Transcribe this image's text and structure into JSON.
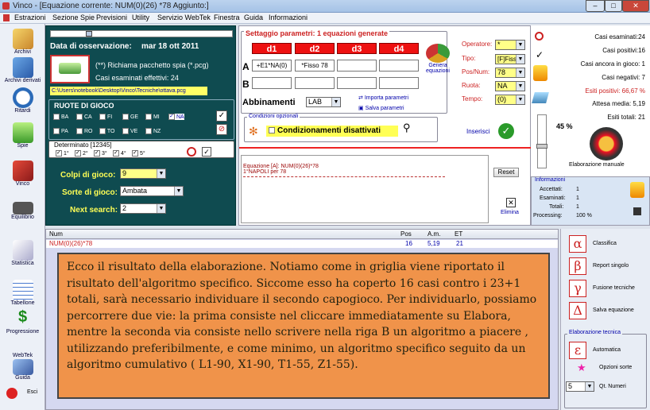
{
  "window": {
    "title": "Vinco - [Equazione corrente: NUM(0)(26) *78 Aggiunto:]"
  },
  "menu": [
    "Estrazioni",
    "Sezione Spie",
    "Previsioni",
    "Utility",
    "Servizio WebTek",
    "Finestra",
    "Guida",
    "Informazioni"
  ],
  "sidebar": [
    "Archivi",
    "Archivi derivati",
    "Ritardi",
    "Spie",
    "Vinco",
    "Equilibrio",
    "Statistica",
    "Tabellone",
    "Progressione",
    "WebTek",
    "Guida",
    "Esci"
  ],
  "obs": {
    "label": "Data di osservazione:",
    "date": "mar 18 ott 2011",
    "recall": "(**) Richiama pacchetto spia (*.pcg)",
    "cases": "Casi esaminati effettivi: 24",
    "path": "C:\\Users\\notebook\\Desktop\\Vinco\\Tecniche\\ottava.pcg"
  },
  "ruote": {
    "title": "RUOTE DI GIOCO",
    "items": [
      "BA",
      "CA",
      "FI",
      "GE",
      "MI",
      "NA",
      "PA",
      "RO",
      "TO",
      "VE",
      "NZ"
    ],
    "checked": "NA"
  },
  "determinato": {
    "title": "Determinato [12345]",
    "items": [
      "1°",
      "2°",
      "3°",
      "4°",
      "5°"
    ]
  },
  "colpi": {
    "label": "Colpi di gioco:",
    "value": "9"
  },
  "sorte": {
    "label": "Sorte di gioco:",
    "value": "Ambata"
  },
  "next": {
    "label": "Next search:",
    "value": "2"
  },
  "settaggio": {
    "title": "Settaggio parametri: 1 equazioni generate",
    "d": [
      "d1",
      "d2",
      "d3",
      "d4"
    ],
    "rowA": [
      "+E1*NA(0)",
      "*Fisso 78",
      "",
      ""
    ],
    "genera": "Genera equazioni"
  },
  "params": {
    "operatore": {
      "label": "Operatore:",
      "value": "*"
    },
    "tipo": {
      "label": "Tipo:",
      "value": "[F]Fisso"
    },
    "posnum": {
      "label": "Pos/Num:",
      "value": "78"
    },
    "ruota": {
      "label": "Ruota:",
      "value": "NA"
    },
    "tempo": {
      "label": "Tempo:",
      "value": "(0)"
    }
  },
  "abbinamenti": {
    "label": "Abbinamenti",
    "value": "LAB",
    "importa": "Importa parametri",
    "salva": "Salva parametri"
  },
  "condizioni": {
    "legend": "Condizioni opzionali",
    "text": "Condizionamenti disattivati",
    "inserisci": "Inserisci"
  },
  "equazione": {
    "line1": "Equazione [A]: NUM(0)(26)*78",
    "line2": "1°NAPOLI per 78",
    "reset": "Reset",
    "elimina": "Elimina"
  },
  "stats": {
    "esaminati": "Casi esaminati:24",
    "positivi": "Casi positivi:16",
    "ancora": "Casi ancora in gioco: 1",
    "negativi": "Casi negativi: 7",
    "esiti": "Esiti positivi: 66,67 %",
    "attesa": "Attesa media: 5,19",
    "totali": "Esiti totali: 21",
    "perc": "45 %",
    "manuale": "Elaborazione manuale"
  },
  "info": {
    "legend": "Informazioni",
    "accettati": "Accettati:",
    "acc_v": "1",
    "esaminati": "Esaminati:",
    "esa_v": "1",
    "totali": "Totali:",
    "tot_v": "1",
    "processing": "Processing:",
    "proc_v": "100 %"
  },
  "grid": {
    "headers": [
      "Num",
      "Pos",
      "A.m.",
      "ET"
    ],
    "row": [
      "NUM(0)(26)*78",
      "16",
      "5,19",
      "21"
    ]
  },
  "message": "Ecco il risultato della elaborazione. Notiamo come in griglia viene riportato il risultato dell'algoritmo specifico. Siccome esso ha coperto 16 casi contro i 23+1 totali, sarà necessario individuare il secondo capogioco. Per individuarlo, possiamo percorrere due vie: la prima consiste nel cliccare immediatamente su Elabora, mentre la seconda via consiste nello scrivere nella riga B un algoritmo a piacere , utilizzando preferibilmente, e come minimo, un algoritmo specifico seguito da un algoritmo cumulativo ( L1-90, X1-90, T1-55, Z1-55).",
  "tools": {
    "classifica": "Classifica",
    "report": "Report singolo",
    "fusione": "Fusione tecniche",
    "salva": "Salva equazione",
    "elab": "Elaborazione tecnica",
    "automatica": "Automatica",
    "opzioni": "Opzioni sorte",
    "qt": "Qt. Numeri",
    "qt_v": "5",
    "alpha": "α",
    "beta": "β",
    "gamma": "γ",
    "delta": "Δ",
    "eps": "ε"
  }
}
